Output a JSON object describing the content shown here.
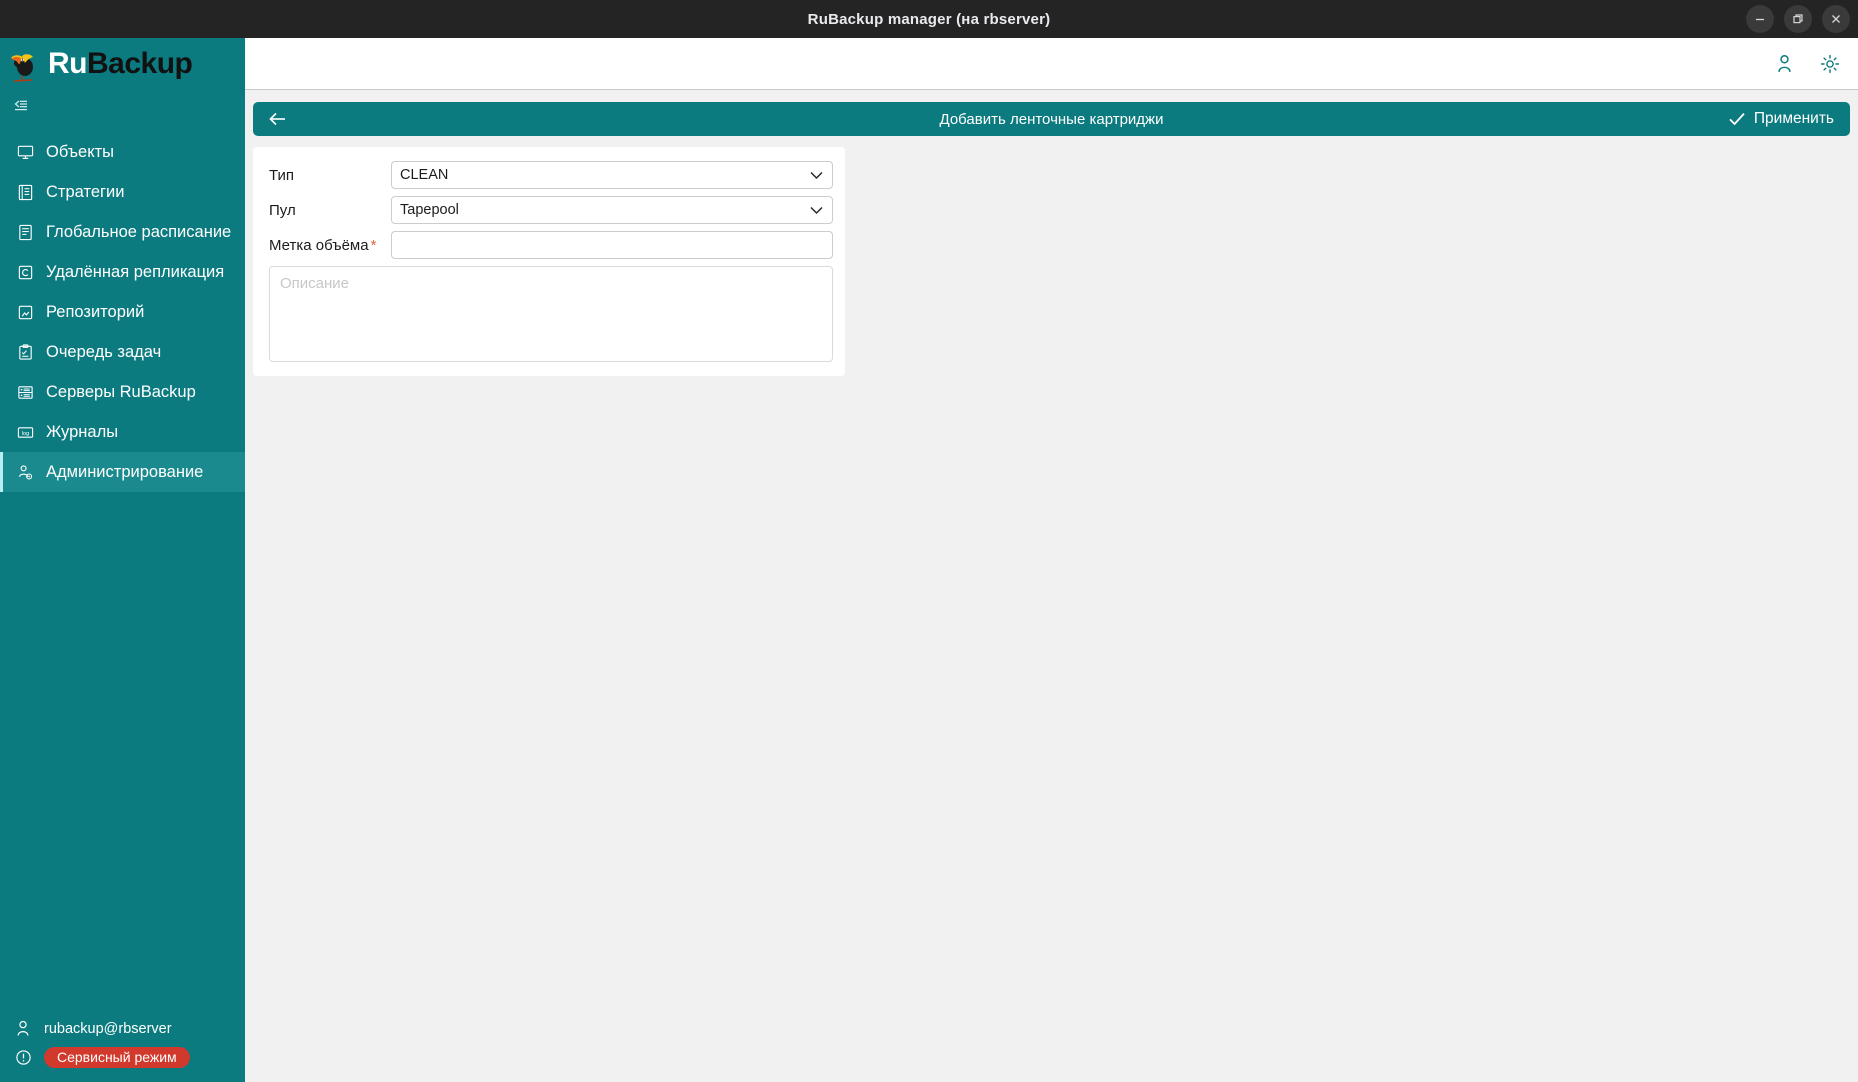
{
  "window": {
    "title": "RuBackup manager (на rbserver)",
    "controls": {
      "minimize": "minimize-icon",
      "maximize": "maximize-icon",
      "close": "close-icon"
    }
  },
  "brand": {
    "ru": "Ru",
    "backup": "Backup",
    "logo_icon": "toucan-logo-icon",
    "collapse_icon": "collapse-sidebar-icon"
  },
  "sidebar": {
    "items": [
      {
        "label": "Объекты",
        "icon": "monitor-icon",
        "active": false
      },
      {
        "label": "Стратегии",
        "icon": "strategy-book-icon",
        "active": false
      },
      {
        "label": "Глобальное расписание",
        "icon": "schedule-list-icon",
        "active": false
      },
      {
        "label": "Удалённая репликация",
        "icon": "replication-icon",
        "active": false
      },
      {
        "label": "Репозиторий",
        "icon": "repository-icon",
        "active": false
      },
      {
        "label": "Очередь задач",
        "icon": "task-queue-icon",
        "active": false
      },
      {
        "label": "Серверы RuBackup",
        "icon": "servers-icon",
        "active": false
      },
      {
        "label": "Журналы",
        "icon": "log-icon",
        "active": false
      },
      {
        "label": "Администрирование",
        "icon": "administration-user-gear-icon",
        "active": true
      }
    ],
    "footer": {
      "user": "rubackup@rbserver",
      "user_icon": "user-icon",
      "service_mode": "Сервисный режим",
      "service_icon": "alert-circle-icon"
    }
  },
  "topbar": {
    "account_icon": "user-account-icon",
    "settings_icon": "gear-icon"
  },
  "page": {
    "back_icon": "arrow-left-icon",
    "title": "Добавить ленточные картриджи",
    "apply_label": "Применить",
    "apply_icon": "check-icon"
  },
  "form": {
    "type": {
      "label": "Тип",
      "value": "CLEAN",
      "chevron_icon": "chevron-down-icon"
    },
    "pool": {
      "label": "Пул",
      "value": "Tapepool",
      "chevron_icon": "chevron-down-icon"
    },
    "volume_label": {
      "label": "Метка объёма",
      "required_marker": "*",
      "value": "",
      "placeholder": ""
    },
    "description": {
      "placeholder": "Описание",
      "value": ""
    }
  },
  "colors": {
    "teal": "#0c7b80",
    "teal_active": "#1b8a8e",
    "titlebar": "#242424",
    "canvas": "#f1f1f1",
    "required_red": "#e2603f",
    "service_badge_red": "#d0392c"
  }
}
